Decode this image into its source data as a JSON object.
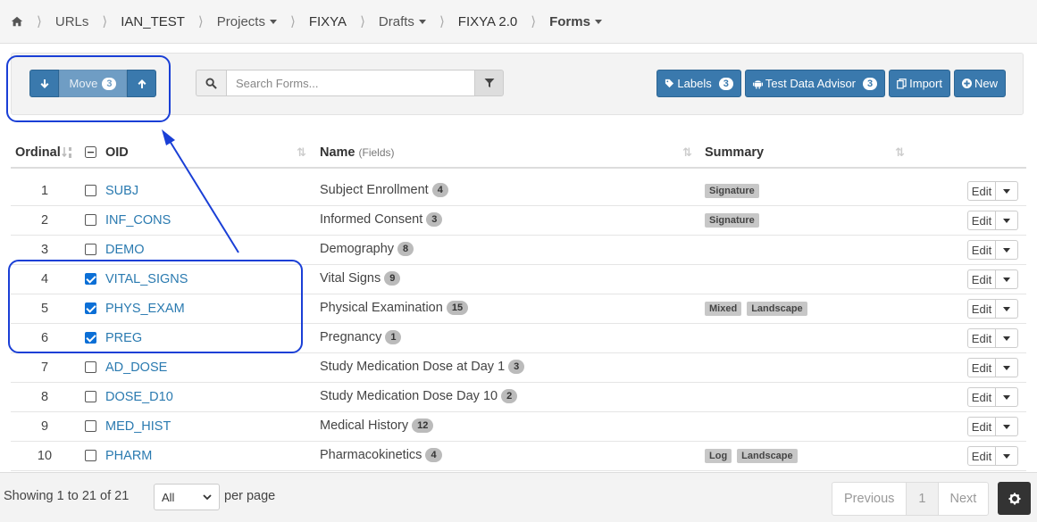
{
  "breadcrumb": {
    "items": [
      {
        "label": "URLs"
      },
      {
        "label": "IAN_TEST"
      },
      {
        "label": "Projects"
      },
      {
        "label": "FIXYA"
      },
      {
        "label": "Drafts"
      },
      {
        "label": "FIXYA 2.0"
      },
      {
        "label": "Forms"
      }
    ]
  },
  "toolbar": {
    "move_label": "Move",
    "move_count": "3",
    "search_placeholder": "Search Forms...",
    "labels_label": "Labels",
    "labels_count": "3",
    "tda_label": "Test Data Advisor",
    "tda_count": "3",
    "import_label": "Import",
    "new_label": "New"
  },
  "table": {
    "headers": {
      "ordinal": "Ordinal",
      "oid": "OID",
      "name": "Name",
      "name_sub": "(Fields)",
      "summary": "Summary"
    },
    "edit_label": "Edit",
    "rows": [
      {
        "ordinal": "1",
        "oid": "SUBJ",
        "name": "Subject Enrollment",
        "fields": "4",
        "checked": false,
        "tags": [
          "Signature"
        ]
      },
      {
        "ordinal": "2",
        "oid": "INF_CONS",
        "name": "Informed Consent",
        "fields": "3",
        "checked": false,
        "tags": [
          "Signature"
        ]
      },
      {
        "ordinal": "3",
        "oid": "DEMO",
        "name": "Demography",
        "fields": "8",
        "checked": false,
        "tags": []
      },
      {
        "ordinal": "4",
        "oid": "VITAL_SIGNS",
        "name": "Vital Signs",
        "fields": "9",
        "checked": true,
        "tags": []
      },
      {
        "ordinal": "5",
        "oid": "PHYS_EXAM",
        "name": "Physical Examination",
        "fields": "15",
        "checked": true,
        "tags": [
          "Mixed",
          "Landscape"
        ]
      },
      {
        "ordinal": "6",
        "oid": "PREG",
        "name": "Pregnancy",
        "fields": "1",
        "checked": true,
        "tags": []
      },
      {
        "ordinal": "7",
        "oid": "AD_DOSE",
        "name": "Study Medication Dose at Day 1",
        "fields": "3",
        "checked": false,
        "tags": []
      },
      {
        "ordinal": "8",
        "oid": "DOSE_D10",
        "name": "Study Medication Dose Day 10",
        "fields": "2",
        "checked": false,
        "tags": []
      },
      {
        "ordinal": "9",
        "oid": "MED_HIST",
        "name": "Medical History",
        "fields": "12",
        "checked": false,
        "tags": []
      },
      {
        "ordinal": "10",
        "oid": "PHARM",
        "name": "Pharmacokinetics",
        "fields": "4",
        "checked": false,
        "tags": [
          "Log",
          "Landscape"
        ]
      }
    ]
  },
  "footer": {
    "showing": "Showing 1 to 21 of 21",
    "per_page_value": "All",
    "per_page_label": "per page",
    "previous": "Previous",
    "page": "1",
    "next": "Next"
  },
  "colors": {
    "primary": "#3a79ad",
    "annotation": "#1a3fd6",
    "link": "#2a7ab0"
  }
}
